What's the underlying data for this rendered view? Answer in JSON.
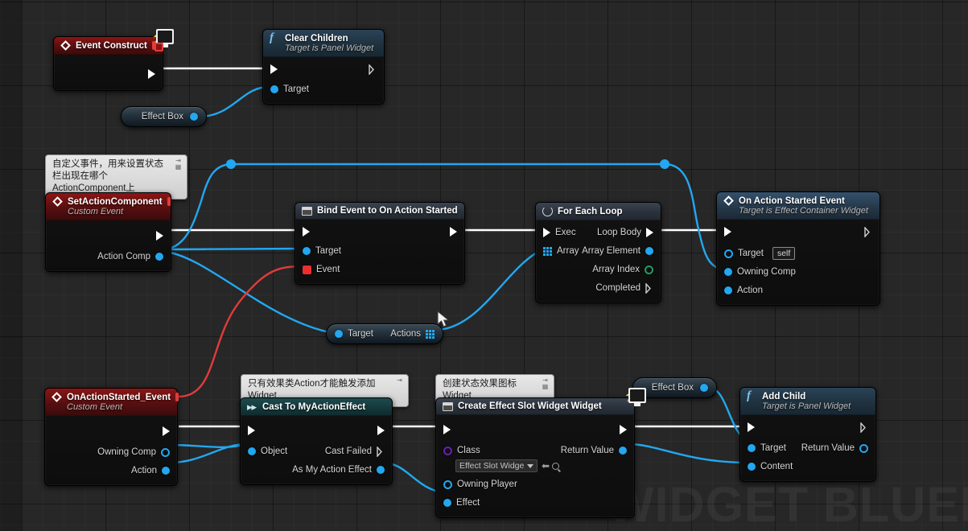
{
  "canvas": {
    "watermark": "WIDGET BLUEPRINT",
    "background_color": "#272727",
    "grid_color": "#303030",
    "exec_wire_color": "#ffffff",
    "object_wire_color": "#22a7f0",
    "delegate_wire_color": "#e23b3b"
  },
  "comments": [
    {
      "id": "comment-set-action-component",
      "text": "自定义事件，用来设置状态栏出现在哪个ActionComponent上"
    },
    {
      "id": "comment-cast",
      "text": "只有效果类Action才能触发添加Widget"
    },
    {
      "id": "comment-create-widget",
      "text": "创建状态效果图标Widget"
    }
  ],
  "nodes": {
    "event_construct": {
      "title": "Event Construct",
      "header_color": "#7a1314",
      "icon": "event-diamond-icon"
    },
    "clear_children": {
      "title": "Clear Children",
      "subtitle": "Target is Panel Widget",
      "icon": "function-f-icon",
      "inputs": [
        {
          "label": "Target",
          "pin": "object"
        }
      ]
    },
    "effect_box_top": {
      "title": "Effect Box",
      "pin": "object"
    },
    "set_action_component": {
      "title": "SetActionComponent",
      "subtitle": "Custom Event",
      "icon": "event-diamond-icon",
      "outputs": [
        {
          "label": "Action Comp",
          "pin": "object"
        }
      ]
    },
    "bind_event": {
      "title": "Bind Event to On Action Started",
      "icon": "widget-icon",
      "inputs": [
        {
          "label": "Target",
          "pin": "object"
        },
        {
          "label": "Event",
          "pin": "delegate"
        }
      ]
    },
    "for_each_loop": {
      "title": "For Each Loop",
      "icon": "loop-icon",
      "inputs": [
        {
          "label": "Exec",
          "pin": "exec"
        },
        {
          "label": "Array",
          "pin": "array"
        }
      ],
      "outputs": [
        {
          "label": "Loop Body",
          "pin": "exec"
        },
        {
          "label": "Array Element",
          "pin": "object"
        },
        {
          "label": "Array Index",
          "pin": "int"
        },
        {
          "label": "Completed",
          "pin": "exec-hollow"
        }
      ]
    },
    "on_action_started_event": {
      "title": "On Action Started Event",
      "subtitle": "Target is Effect Container Widget",
      "icon": "event-diamond-icon",
      "inputs": [
        {
          "label": "Target",
          "pin": "object-hollow",
          "value": "self"
        },
        {
          "label": "Owning Comp",
          "pin": "object"
        },
        {
          "label": "Action",
          "pin": "object"
        }
      ]
    },
    "target_actions": {
      "input_label": "Target",
      "output_label": "Actions"
    },
    "on_action_started_custom": {
      "title": "OnActionStarted_Event",
      "subtitle": "Custom Event",
      "icon": "event-diamond-icon",
      "outputs": [
        {
          "label": "Owning Comp",
          "pin": "object-hollow"
        },
        {
          "label": "Action",
          "pin": "object"
        }
      ]
    },
    "cast_to_my_action_effect": {
      "title": "Cast To MyActionEffect",
      "icon": "cast-icon",
      "inputs": [
        {
          "label": "Object",
          "pin": "object"
        }
      ],
      "outputs": [
        {
          "label": "Cast Failed",
          "pin": "exec-hollow"
        },
        {
          "label": "As My Action Effect",
          "pin": "object"
        }
      ]
    },
    "create_effect_slot_widget": {
      "title": "Create Effect Slot Widget Widget",
      "icon": "widget-icon",
      "inputs": [
        {
          "label": "Class",
          "pin": "class"
        },
        {
          "label": "Owning Player",
          "pin": "object-hollow"
        },
        {
          "label": "Effect",
          "pin": "object"
        }
      ],
      "class_value": "Effect Slot Widge:",
      "outputs": [
        {
          "label": "Return Value",
          "pin": "object"
        }
      ]
    },
    "effect_box_bottom": {
      "title": "Effect Box",
      "pin": "object"
    },
    "add_child": {
      "title": "Add Child",
      "subtitle": "Target is Panel Widget",
      "icon": "function-f-icon",
      "inputs": [
        {
          "label": "Target",
          "pin": "object"
        },
        {
          "label": "Content",
          "pin": "object"
        }
      ],
      "outputs": [
        {
          "label": "Return Value",
          "pin": "object-hollow"
        }
      ]
    }
  }
}
